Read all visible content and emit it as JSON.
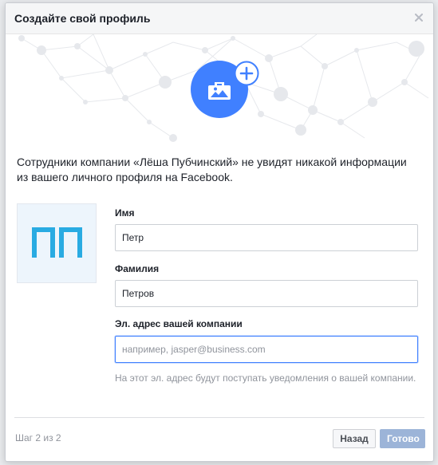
{
  "dialog": {
    "title": "Создайте свой профиль",
    "close_icon": "close-icon"
  },
  "hero": {
    "icon": "briefcase-image-icon",
    "badge_icon": "plus-icon",
    "accent_color": "#4080ff"
  },
  "intro": {
    "text": "Сотрудники компании «Лёша Пубчинский» не увидят никакой информации из вашего личного профиля на Facebook."
  },
  "avatar": {
    "initials": "ПП",
    "color": "#29abe2"
  },
  "form": {
    "first_name_label": "Имя",
    "first_name_value": "Петр",
    "last_name_label": "Фамилия",
    "last_name_value": "Петров",
    "email_label": "Эл. адрес вашей компании",
    "email_value": "",
    "email_placeholder": "например, jasper@business.com",
    "email_hint": "На этот эл. адрес будут поступать уведомления о вашей компании."
  },
  "footer": {
    "step_text": "Шаг 2 из 2",
    "back_label": "Назад",
    "done_label": "Готово"
  }
}
